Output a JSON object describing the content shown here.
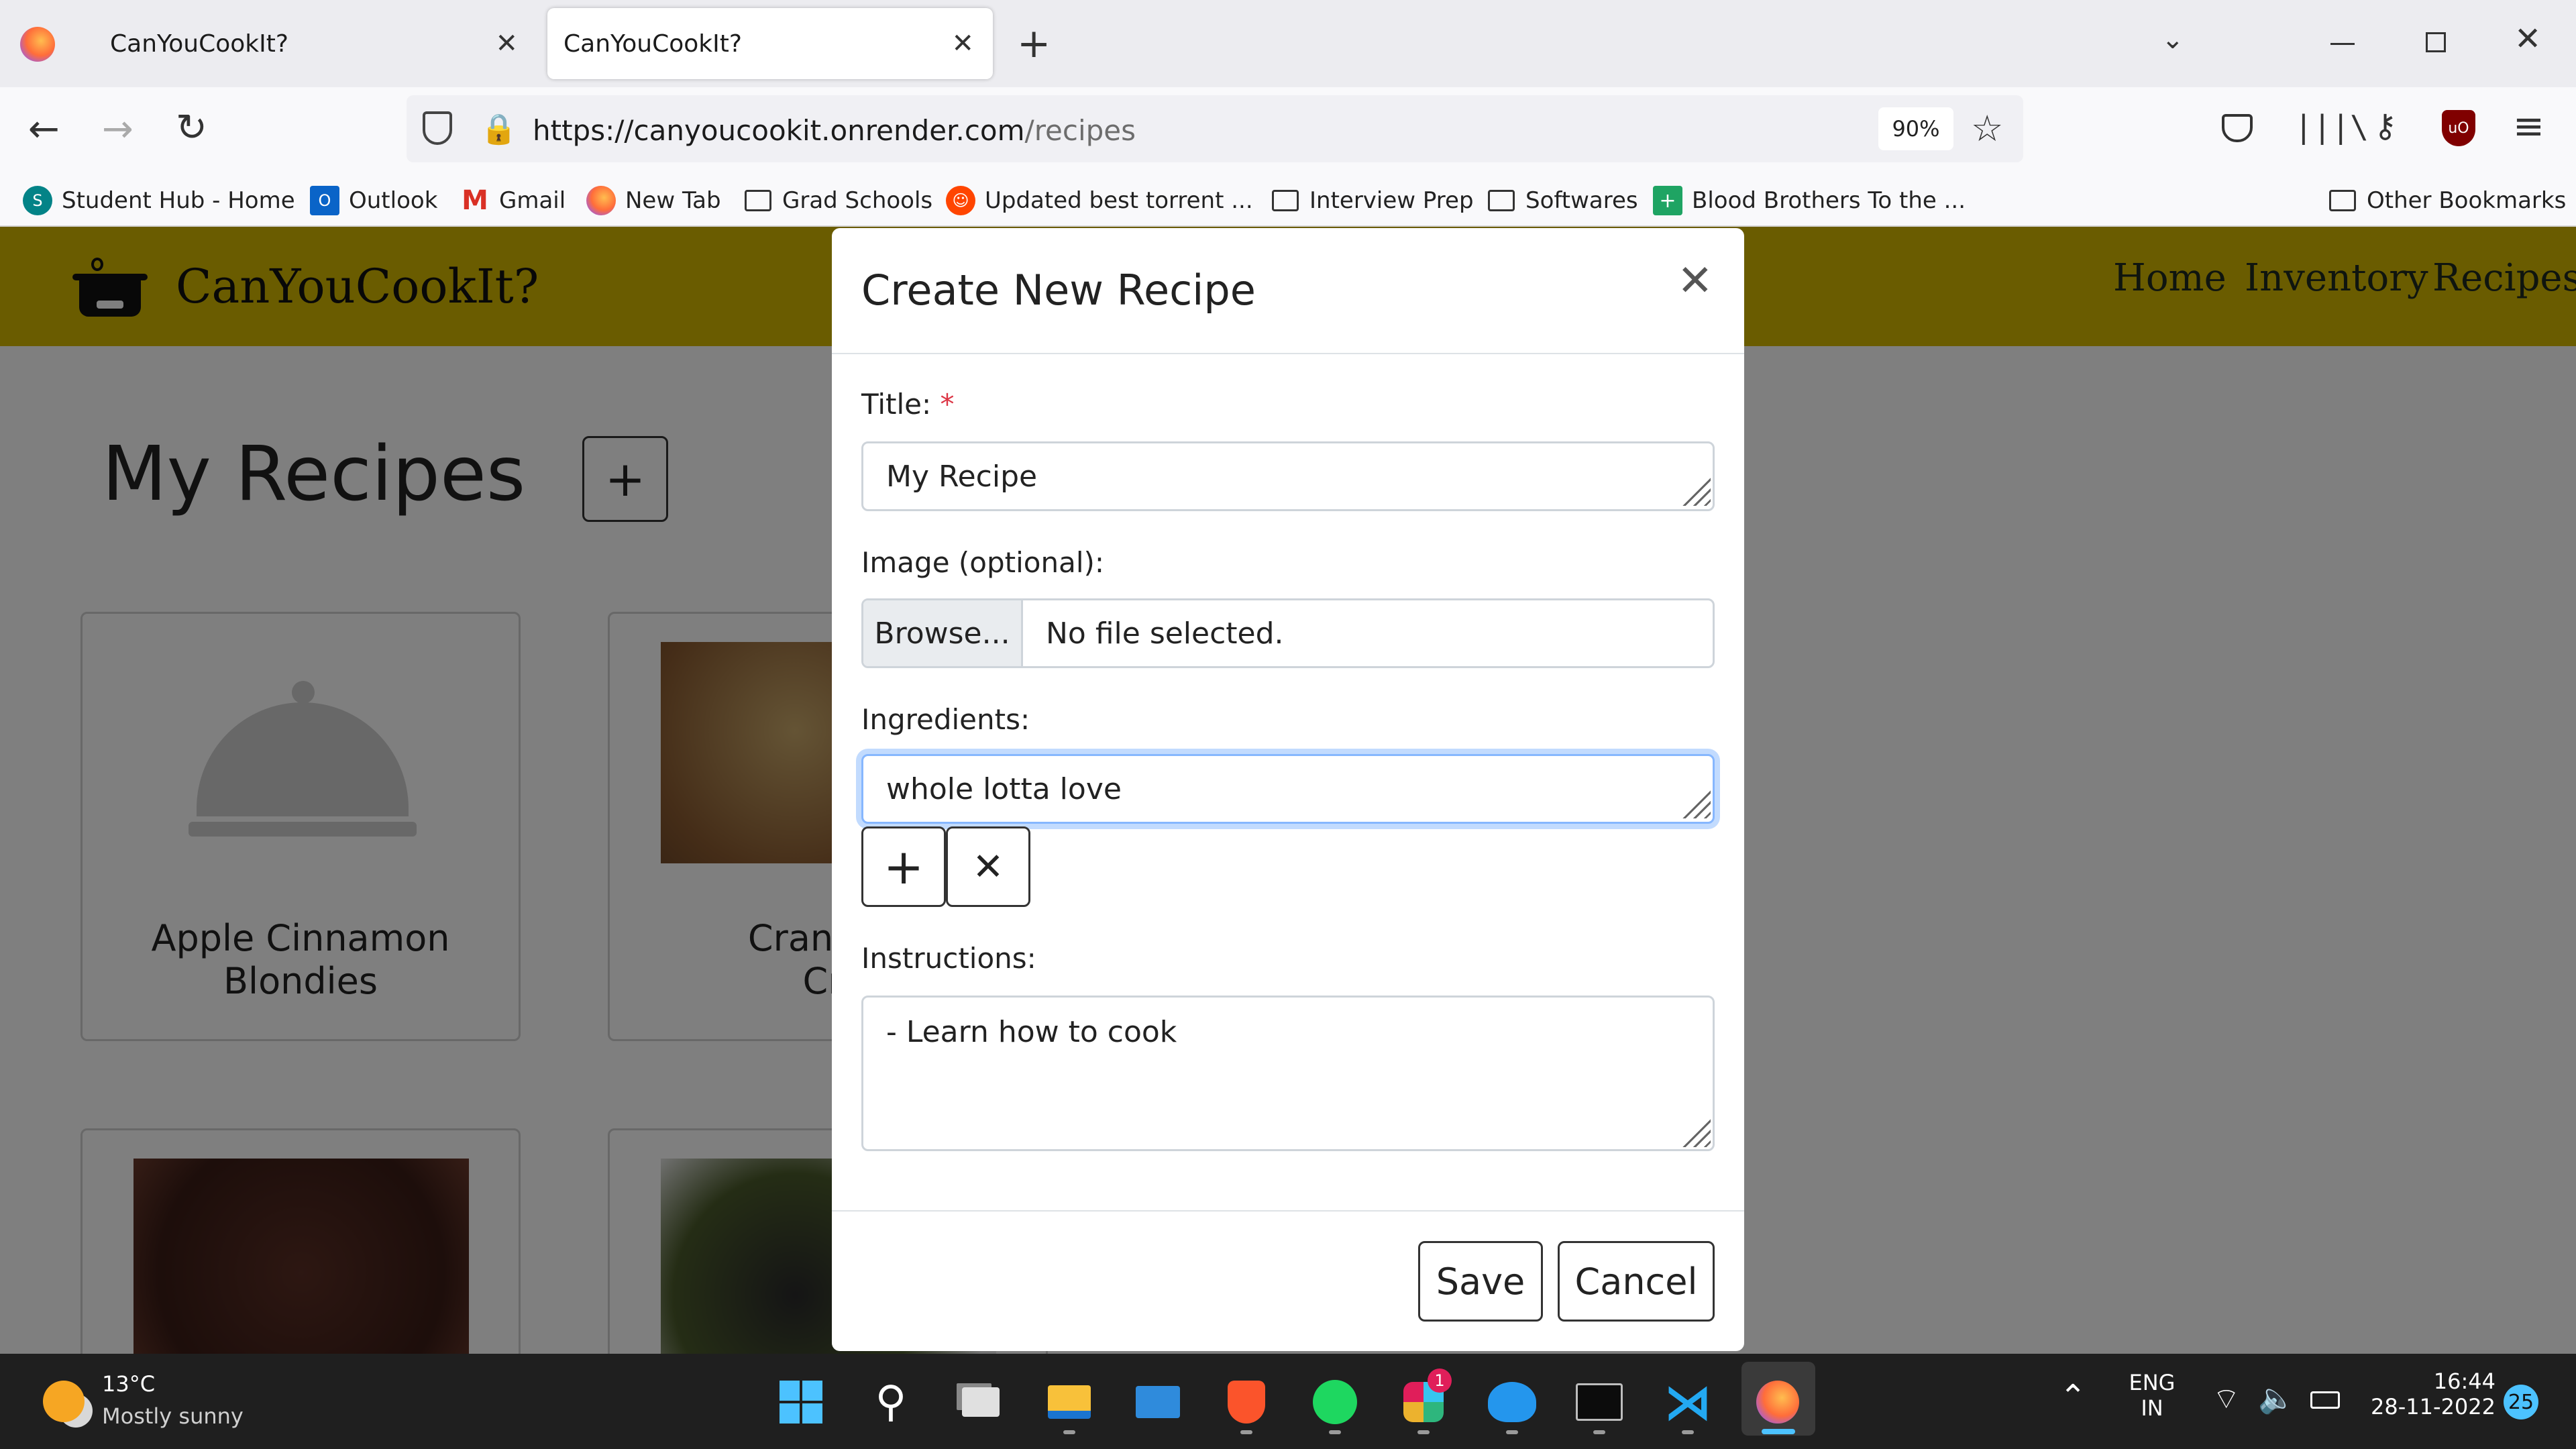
{
  "browser": {
    "tabs": [
      {
        "title": "CanYouCookIt?",
        "active": false
      },
      {
        "title": "CanYouCookIt?",
        "active": true
      }
    ],
    "url_host": "https://canyoucookit.onrender.com",
    "url_path": "/recipes",
    "zoom": "90%",
    "bookmarks": [
      "Student Hub - Home",
      "Outlook",
      "Gmail",
      "New Tab",
      "Grad Schools",
      "Updated best torrent ...",
      "Interview Prep",
      "Softwares",
      "Blood Brothers To the ..."
    ],
    "other_bookmarks": "Other Bookmarks"
  },
  "site": {
    "brand": "CanYouCookIt?",
    "nav": [
      "Home",
      "Inventory",
      "Recipes"
    ],
    "heading": "My Recipes",
    "cards": [
      {
        "title_line1": "Apple Cinnamon",
        "title_line2": "Blondies"
      },
      {
        "title_line1": "Cranberr",
        "title_line2": "Cri"
      }
    ]
  },
  "modal": {
    "title": "Create New Recipe",
    "title_label": "Title:",
    "required_mark": "*",
    "title_value": "My Recipe",
    "image_label": "Image (optional):",
    "browse_label": "Browse...",
    "file_status": "No file selected.",
    "ingredients_label": "Ingredients:",
    "ingredient_value": "whole lotta love",
    "instructions_label": "Instructions:",
    "instructions_value": "- Learn how to cook",
    "save_label": "Save",
    "cancel_label": "Cancel"
  },
  "taskbar": {
    "temperature": "13°C",
    "weather": "Mostly sunny",
    "lang_line1": "ENG",
    "lang_line2": "IN",
    "time": "16:44",
    "date": "28-11-2022",
    "slack_badge": "1",
    "notifications": "25"
  },
  "colors": {
    "navbar": "#d4b800",
    "overlay": "rgba(0,0,0,0.5)",
    "focus_ring": "#86b7fe",
    "required": "#dc3545"
  }
}
